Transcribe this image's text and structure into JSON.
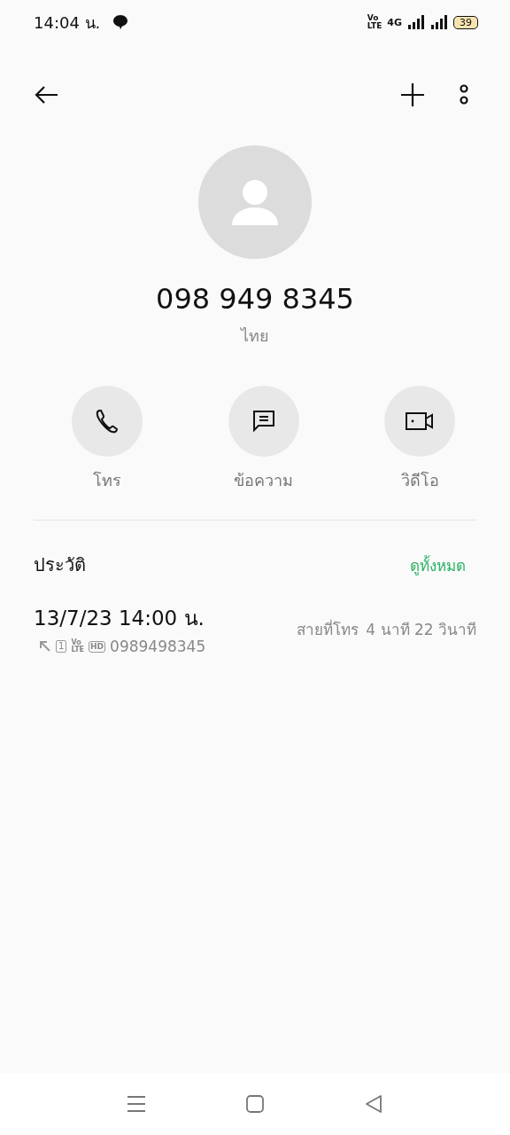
{
  "status_bar": {
    "time": "14:04 น.",
    "volte_top": "Vo",
    "volte_bottom": "LTE",
    "network": "4G",
    "battery": "39"
  },
  "contact": {
    "number": "098 949 8345",
    "location": "ไทย"
  },
  "actions": [
    {
      "kind": "call",
      "label": "โทร"
    },
    {
      "kind": "message",
      "label": "ข้อความ"
    },
    {
      "kind": "video",
      "label": "วิดีโอ"
    }
  ],
  "history": {
    "title": "ประวัติ",
    "view_all": "ดูทั้งหมด",
    "calls": [
      {
        "datetime": "13/7/23 14:00 น.",
        "sim": "1",
        "volte_top": "Vo",
        "volte_bottom": "LTE",
        "hd": "HD",
        "number": "0989498345",
        "type": "สายที่โทร",
        "duration": "4 นาที 22 วินาที"
      }
    ]
  }
}
